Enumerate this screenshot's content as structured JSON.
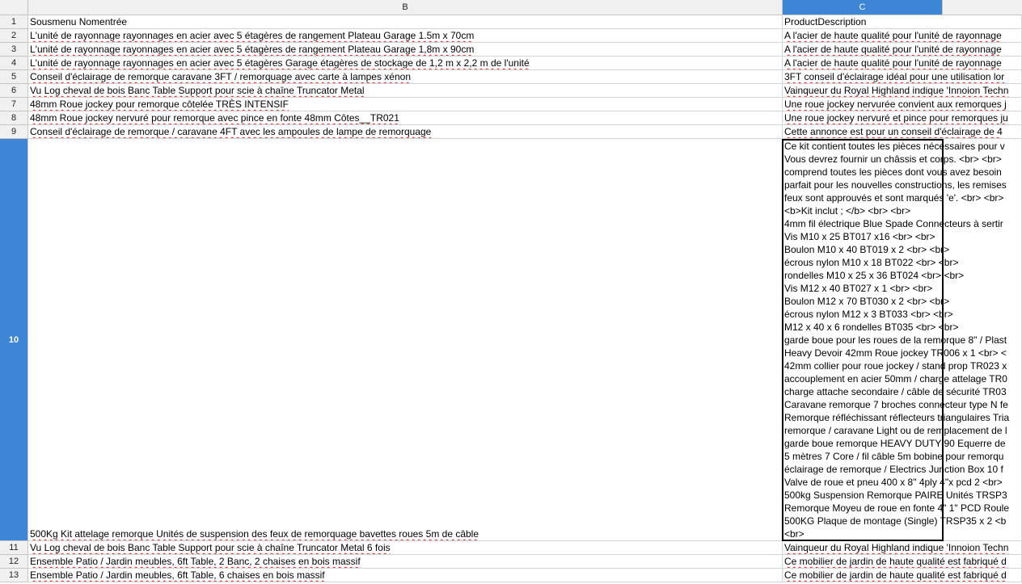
{
  "columns": {
    "b": "B",
    "c": "C"
  },
  "rows": [
    {
      "num": "1",
      "b": "Sousmenu Nomentrée",
      "c": "ProductDescription"
    },
    {
      "num": "2",
      "b": "L'unité de rayonnage rayonnages en acier avec 5 étagères de rangement Plateau Garage 1.5m x 70cm",
      "c": "A l'acier de haute qualité pour l'unité de rayonnage"
    },
    {
      "num": "3",
      "b": "L'unité de rayonnage rayonnages en acier avec 5 étagères de rangement Plateau Garage 1,8m x 90cm",
      "c": "A l'acier de haute qualité pour l'unité de rayonnage"
    },
    {
      "num": "4",
      "b": "L'unité de rayonnage rayonnages en acier avec 5 étagères Garage étagères de stockage de 1,2 m x 2,2 m de l'unité",
      "c": "A l'acier de haute qualité pour l'unité de rayonnage"
    },
    {
      "num": "5",
      "b": "Conseil d'éclairage de remorque caravane 3FT / remorquage avec carte à lampes xénon",
      "c": "3FT conseil d'éclairage idéal pour une utilisation lor"
    },
    {
      "num": "6",
      "b": "Vu Log cheval de bois Banc Table Support pour scie à chaîne Truncator Metal",
      "c": "Vainqueur du Royal Highland indique 'Innoion Techn"
    },
    {
      "num": "7",
      "b": "48mm Roue jockey pour remorque côtelée TRÈS INTENSIF",
      "c": "Une roue jockey nervurée convient aux remorques j"
    },
    {
      "num": "8",
      "b": "48mm Roue jockey nervuré pour remorque avec pince en fonte 48mm Côtes__TR021",
      "c": "Une roue jockey nervuré et pince pour remorques ju"
    },
    {
      "num": "9",
      "b": "Conseil d'éclairage de remorque / caravane 4FT avec les ampoules de lampe de remorquage",
      "c": "Cette annonce est pour un conseil d'éclairage de 4"
    },
    {
      "num": "10",
      "b": "500Kg Kit attelage remorque Unités de suspension des feux de remorquage bavettes roues 5m de câble",
      "c": ""
    },
    {
      "num": "11",
      "b": "Vu Log cheval de bois Banc Table Support pour scie à chaîne Truncator Metal 6 fois",
      "c": "Vainqueur du Royal Highland indique 'Innoion Techn"
    },
    {
      "num": "12",
      "b": "Ensemble Patio / Jardin meubles, 6ft Table, 2 Banc, 2 chaises en bois massif",
      "c": "Ce mobilier de jardin de haute qualité est fabriqué d"
    },
    {
      "num": "13",
      "b": "Ensemble Patio / Jardin meubles, 6ft Table, 6 chaises en bois massif",
      "c": "Ce mobilier de jardin de haute qualité est fabriqué d"
    }
  ],
  "row10_c_lines": [
    "Ce kit contient toutes les pièces nécessaires pour v",
    "Vous devrez fournir un châssis et corps. <br> <br>",
    "comprend toutes les pièces dont vous avez besoin",
    "parfait pour les nouvelles constructions, les remises",
    "feux sont approuvés et sont marqués 'e'. <br> <br>",
    " <b>Kit inclut ; </b> <br> <br>",
    "4mm fil électrique Blue Spade Connecteurs à sertir",
    "Vis M10 x 25 BT017 x16 <br> <br>",
    "Boulon M10 x 40 BT019 x 2 <br> <br>",
    "écrous nylon M10 x 18 BT022 <br> <br>",
    "rondelles M10 x 25 x 36 BT024 <br> <br>",
    "Vis M12 x 40 BT027 x 1 <br> <br>",
    "Boulon M12 x 70 BT030 x 2 <br> <br>",
    "écrous nylon M12 x 3 BT033 <br> <br>",
    "M12 x 40 x 6 rondelles BT035  <br> <br>",
    "garde boue pour les roues de la remorque 8\" / Plast",
    "Heavy Devoir 42mm Roue jockey TR006 x 1 <br> <",
    "42mm collier pour roue jockey / stand prop TR023 x",
    "accouplement en acier 50mm / charge attelage TR0",
    "charge attache secondaire / câble de sécurité TR03",
    "Caravane remorque 7 broches connecteur type N fe",
    "Remorque réfléchissant réflecteurs triangulaires Tria",
    "remorque / caravane Light ou de remplacement de l",
    "garde boue remorque HEAVY DUTY 90 Equerre de",
    "5 mètres 7 Core / fil câble 5m bobine pour remorqu",
    "éclairage de remorque / Electrics Junction Box 10 f",
    "Valve de roue et pneu 400 x 8\" 4ply 4\"x pcd 2 <br>",
    "500kg Suspension Remorque PAIRE Unités TRSP3",
    "Remorque Moyeu de roue en fonte 4\" 1\" PCD Roule",
    "500KG Plaque de montage (Single) TRSP35 x 2 <b",
    " <br>"
  ]
}
